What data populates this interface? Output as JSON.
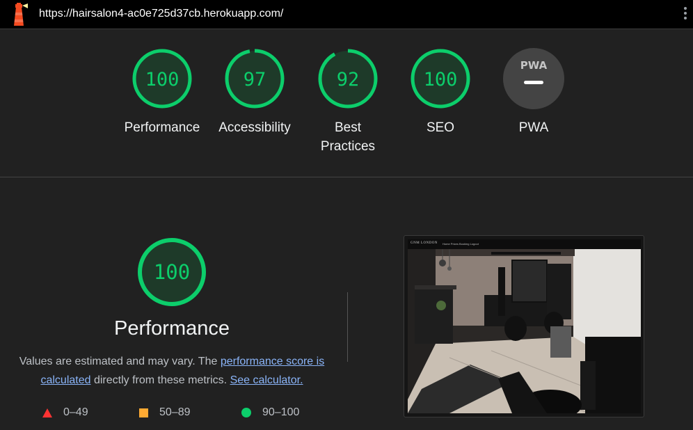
{
  "url": "https://hairsalon4-ac0e725d37cb.herokuapp.com/",
  "icons": {
    "logo": "lighthouse-logo-icon",
    "menu": "more-vertical-icon",
    "pwa": "pwa-badge-icon"
  },
  "colors": {
    "pass": "#0cce6b",
    "average": "#ffaa33",
    "fail": "#ff3333",
    "link": "#8ab4f8"
  },
  "gauges": [
    {
      "score": "100",
      "label": "Performance"
    },
    {
      "score": "97",
      "label": "Accessibility"
    },
    {
      "score": "92",
      "label": "Best Practices"
    },
    {
      "score": "100",
      "label": "SEO"
    },
    {
      "score": "",
      "badge": "PWA",
      "label": "PWA"
    }
  ],
  "performance": {
    "score": "100",
    "title": "Performance",
    "desc_start": "Values are estimated and may vary. The ",
    "link_score": "performance score is calculated",
    "desc_middle": " directly from these metrics. ",
    "link_calc": "See calculator.",
    "legend": [
      {
        "shape": "triangle",
        "range": "0–49"
      },
      {
        "shape": "square",
        "range": "50–89"
      },
      {
        "shape": "circle",
        "range": "90–100"
      }
    ]
  },
  "screenshot": {
    "brand": "GNM LONDON",
    "nav_links": "Home   Prices   Booking   Logout"
  }
}
